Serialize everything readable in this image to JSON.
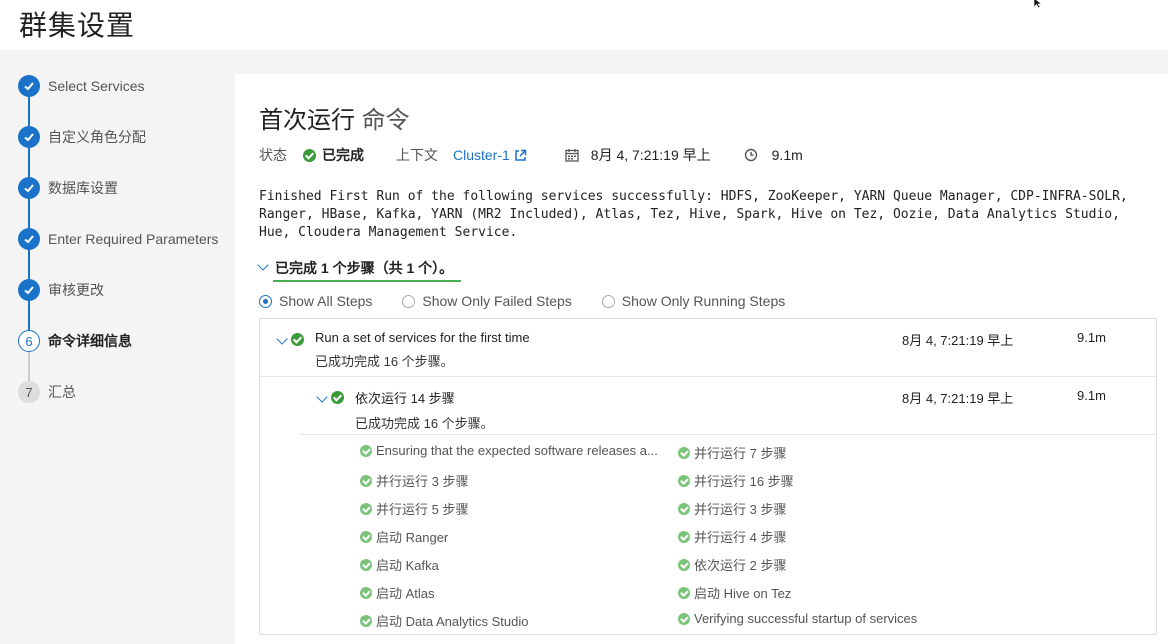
{
  "page_title": "群集设置",
  "wizard": {
    "steps": [
      {
        "label": "Select Services",
        "state": "done"
      },
      {
        "label": "自定义角色分配",
        "state": "done"
      },
      {
        "label": "数据库设置",
        "state": "done"
      },
      {
        "label": "Enter Required Parameters",
        "state": "done"
      },
      {
        "label": "审核更改",
        "state": "done"
      },
      {
        "label": "命令详细信息",
        "state": "current",
        "number": "6"
      },
      {
        "label": "汇总",
        "state": "pending",
        "number": "7"
      }
    ]
  },
  "command": {
    "title": "首次运行",
    "title_suffix": "命令",
    "status_label": "状态",
    "status_value": "已完成",
    "context_label": "上下文",
    "context_link": "Cluster-1",
    "date": "8月 4, 7:21:19 早上",
    "duration": "9.1m",
    "message": "Finished First Run of the following services successfully: HDFS, ZooKeeper, YARN Queue Manager, CDP-INFRA-SOLR, Ranger, HBase, Kafka, YARN (MR2 Included), Atlas, Tez, Hive, Spark, Hive on Tez, Oozie, Data Analytics Studio, Hue, Cloudera Management Service.",
    "summary": "已完成 1 个步骤（共 1 个）。"
  },
  "filters": [
    {
      "label": "Show All Steps",
      "selected": true
    },
    {
      "label": "Show Only Failed Steps",
      "selected": false
    },
    {
      "label": "Show Only Running Steps",
      "selected": false
    }
  ],
  "steps": {
    "top": {
      "title": "Run a set of services for the first time",
      "sub": "已成功完成  16  个步骤。",
      "time": "8月 4, 7:21:19 早上",
      "duration": "9.1m"
    },
    "child": {
      "title": "依次运行 14 步骤",
      "sub": "已成功完成  16  个步骤。",
      "time": "8月 4, 7:21:19 早上",
      "duration": "9.1m"
    },
    "left_col": [
      "Ensuring that the expected software releases a...",
      "并行运行 3 步骤",
      "并行运行 5 步骤",
      "启动 Ranger",
      "启动 Kafka",
      "启动 Atlas",
      "启动 Data Analytics Studio"
    ],
    "right_col": [
      "并行运行 7 步骤",
      "并行运行 16 步骤",
      "并行运行 3 步骤",
      "并行运行 4 步骤",
      "依次运行 2 步骤",
      "启动 Hive on Tez",
      "Verifying successful startup of services"
    ]
  },
  "colors": {
    "accent": "#1a73c8",
    "success": "#3a9b3a"
  }
}
